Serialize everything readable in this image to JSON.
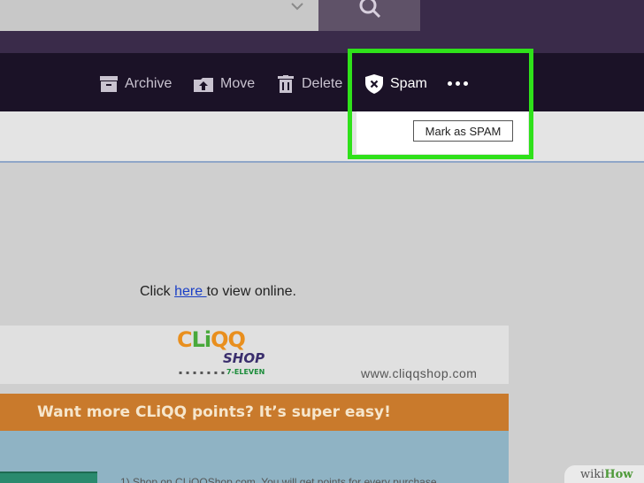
{
  "toolbar": {
    "archive_label": "Archive",
    "move_label": "Move",
    "delete_label": "Delete",
    "spam_label": "Spam"
  },
  "tooltip": {
    "text": "Mark as SPAM"
  },
  "email": {
    "view_online_prefix": "Click ",
    "view_online_link": "here ",
    "view_online_suffix": "to view online.",
    "logo_top_c": "C",
    "logo_top_li": "Li",
    "logo_top_qq": "QQ",
    "logo_shop": "SHOP",
    "logo_eleven": "7-ELEVEN",
    "site_url": "www.cliqqshop.com",
    "promo_text": "Want more CLiQQ points? It’s super easy!",
    "blue_text": "1) Shop on CLiQQShop.com. You will get points for every purchase"
  },
  "watermark": {
    "wiki": "wiki",
    "how": "How"
  },
  "colors": {
    "highlight": "#2fe11a",
    "toolbar_bg": "#1b1227",
    "promo_bg": "#c97a2c"
  },
  "icons": [
    "chevron-down-icon",
    "search-icon",
    "archive-icon",
    "move-icon",
    "trash-icon",
    "shield-x-icon",
    "more-icon"
  ]
}
